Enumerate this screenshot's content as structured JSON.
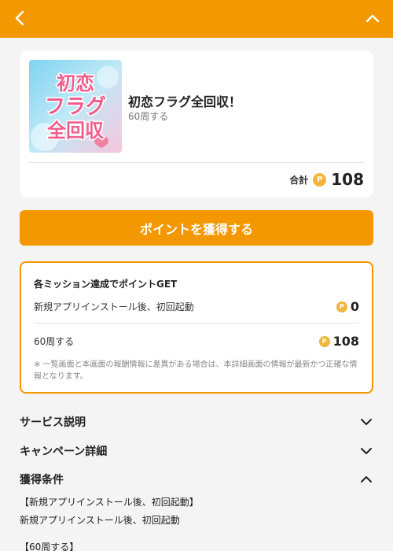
{
  "header": {
    "back_icon": "chevron-left-icon",
    "collapse_icon": "chevron-up-icon",
    "bg_color": "#f39800"
  },
  "offer": {
    "thumbnail_text": "初恋フラグ全回収",
    "title": "初恋フラグ全回収！",
    "subtitle": "60周する",
    "total_label": "合計",
    "total_value": "108",
    "coin_symbol": "P"
  },
  "cta": {
    "label": "ポイントを獲得する"
  },
  "missions": {
    "heading": "各ミッション達成でポイントGET",
    "items": [
      {
        "name": "新規アプリインストール後、初回起動",
        "points": "0"
      },
      {
        "name": "60周する",
        "points": "108"
      }
    ],
    "note": "※ 一覧画面と本画面の報酬情報に差異がある場合は、本詳細画面の情報が最新かつ正確な情報となります。"
  },
  "accordions": [
    {
      "label": "サービス説明",
      "state": "collapsed"
    },
    {
      "label": "キャンペーン詳細",
      "state": "collapsed"
    },
    {
      "label": "獲得条件",
      "state": "expanded"
    }
  ],
  "conditions": {
    "heading1": "【新規アプリインストール後、初回起動】",
    "text1": "新規アプリインストール後、初回起動",
    "heading2": "【60周する】"
  },
  "colors": {
    "accent": "#f39800",
    "coin": "#f3b53b",
    "background": "#f4f4f4"
  }
}
